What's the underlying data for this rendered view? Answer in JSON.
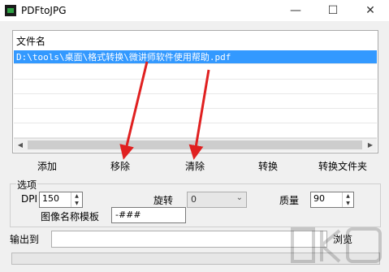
{
  "window": {
    "title": "PDFtoJPG",
    "minimize": "—",
    "maximize": "☐",
    "close": "✕"
  },
  "file_list": {
    "header": "文件名",
    "rows": [
      "D:\\tools\\桌面\\格式转换\\微讲师软件使用帮助.pdf"
    ]
  },
  "actions": {
    "add": "添加",
    "remove": "移除",
    "clear": "清除",
    "convert": "转换",
    "convert_folder": "转换文件夹"
  },
  "options": {
    "legend": "选项",
    "dpi_label": "DPI",
    "dpi_value": "150",
    "rotate_label": "旋转",
    "rotate_value": "0",
    "quality_label": "质量",
    "quality_value": "90",
    "name_template_label": "图像名称模板",
    "name_template_value": "-###"
  },
  "output": {
    "label": "输出到",
    "value": "",
    "browse": "浏览"
  },
  "progress": {
    "value": 0
  },
  "colors": {
    "selection": "#3399ff",
    "arrow": "#e02020"
  },
  "icons": {
    "app": "pdftojpg-app-icon"
  }
}
